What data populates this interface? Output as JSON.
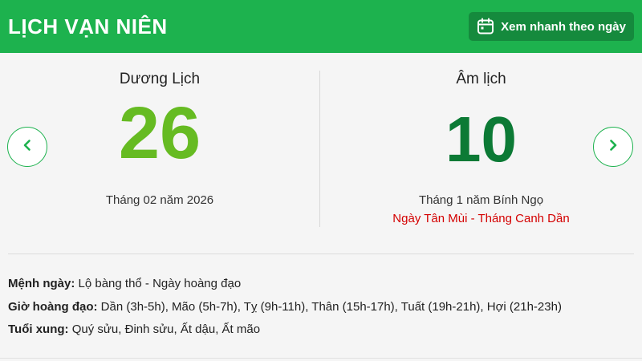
{
  "header": {
    "title": "LỊCH VẠN NIÊN",
    "quick_view_label": "Xem nhanh theo ngày",
    "quick_view_icon": "calendar-icon",
    "brand_color": "#1db24e"
  },
  "solar": {
    "title": "Dương Lịch",
    "day": "26",
    "month_year": "Tháng 02 năm 2026",
    "day_color": "#66bb22"
  },
  "lunar": {
    "title": "Âm lịch",
    "day": "10",
    "month_year": "Tháng 1 năm Bính Ngọ",
    "can_chi": "Ngày Tân Mùi - Tháng Canh Dần",
    "day_color": "#0c7a35",
    "can_chi_color": "#d40000"
  },
  "nav": {
    "prev_icon": "chevron-left-icon",
    "next_icon": "chevron-right-icon"
  },
  "info": {
    "menh_label": "Mệnh ngày:",
    "menh_value": " Lộ bàng thổ - Ngày hoàng đạo",
    "gio_label": "Giờ hoàng đạo:",
    "gio_value": " Dần (3h-5h), Mão (5h-7h), Tỵ (9h-11h), Thân (15h-17h), Tuất (19h-21h), Hợi (21h-23h)",
    "tuoi_label": "Tuổi xung:",
    "tuoi_value": " Quý sửu, Đinh sửu, Ất dậu, Ất mão"
  }
}
